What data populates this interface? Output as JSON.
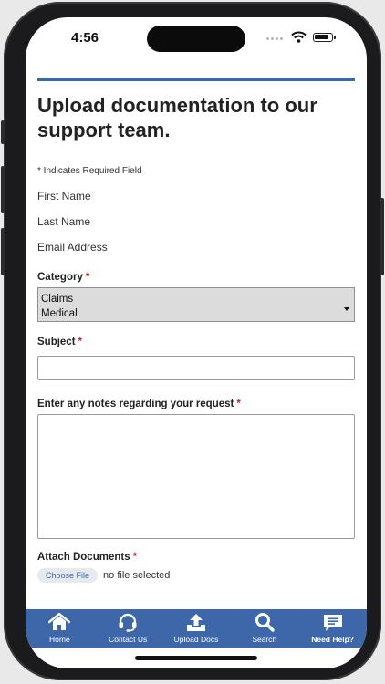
{
  "status": {
    "time": "4:56"
  },
  "form": {
    "title": "Upload documentation to our support team.",
    "required_note": "* Indicates Required Field",
    "first_name_label": "First Name",
    "last_name_label": "Last Name",
    "email_label": "Email Address",
    "category_label": "Category",
    "category_selected_line1": "Claims",
    "category_selected_line2": "Medical",
    "subject_label": "Subject",
    "subject_value": "",
    "notes_label": "Enter any notes regarding your request",
    "notes_value": "",
    "attach_label": "Attach Documents",
    "choose_file_label": "Choose File",
    "file_status": "no file selected",
    "required_marker": "*"
  },
  "tabs": [
    {
      "label": "Home",
      "icon": "home-icon"
    },
    {
      "label": "Contact Us",
      "icon": "headset-icon"
    },
    {
      "label": "Upload Docs",
      "icon": "upload-icon"
    },
    {
      "label": "Search",
      "icon": "search-icon"
    },
    {
      "label": "Need Help?",
      "icon": "chat-icon"
    }
  ],
  "colors": {
    "brand_blue": "#3d67a8",
    "required_red": "#c0262c"
  }
}
